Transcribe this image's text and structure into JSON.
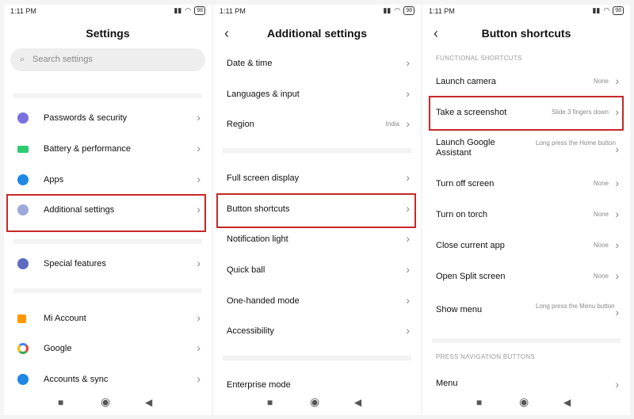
{
  "status": {
    "time": "1:11 PM",
    "battery": "98"
  },
  "screen1": {
    "title": "Settings",
    "search_placeholder": "Search settings",
    "items": [
      {
        "label": "Passwords & security",
        "icon": "fingerprint-icon",
        "color": "#7c6fe0"
      },
      {
        "label": "Battery & performance",
        "icon": "battery-icon",
        "color": "#2ecc71"
      },
      {
        "label": "Apps",
        "icon": "gear-icon",
        "color": "#1e88e5"
      },
      {
        "label": "Additional settings",
        "icon": "more-icon",
        "color": "#9fa8da"
      },
      {
        "label": "Special features",
        "icon": "special-icon",
        "color": "#5c6bc0"
      },
      {
        "label": "Mi Account",
        "icon": "mi-icon",
        "color": "#ff9800"
      },
      {
        "label": "Google",
        "icon": "google-icon",
        "color": "#4285f4"
      },
      {
        "label": "Accounts & sync",
        "icon": "person-icon",
        "color": "#1e88e5"
      }
    ]
  },
  "screen2": {
    "title": "Additional settings",
    "items": [
      {
        "label": "Date & time",
        "value": ""
      },
      {
        "label": "Languages & input",
        "value": ""
      },
      {
        "label": "Region",
        "value": "India"
      },
      {
        "label": "Full screen display",
        "value": ""
      },
      {
        "label": "Button shortcuts",
        "value": ""
      },
      {
        "label": "Notification light",
        "value": ""
      },
      {
        "label": "Quick ball",
        "value": ""
      },
      {
        "label": "One-handed mode",
        "value": ""
      },
      {
        "label": "Accessibility",
        "value": ""
      },
      {
        "label": "Enterprise mode",
        "value": ""
      }
    ]
  },
  "screen3": {
    "title": "Button shortcuts",
    "section1": "FUNCTIONAL SHORTCUTS",
    "section2": "PRESS NAVIGATION BUTTONS",
    "items": [
      {
        "label": "Launch camera",
        "value": "None"
      },
      {
        "label": "Take a screenshot",
        "value": "Slide 3 fingers down"
      },
      {
        "label": "Launch Google Assistant",
        "value": "Long press the Home button"
      },
      {
        "label": "Turn off screen",
        "value": "None"
      },
      {
        "label": "Turn on torch",
        "value": "None"
      },
      {
        "label": "Close current app",
        "value": "None"
      },
      {
        "label": "Open Split screen",
        "value": "None"
      },
      {
        "label": "Show menu",
        "value": "Long press the Menu button"
      },
      {
        "label": "Menu",
        "value": ""
      }
    ]
  },
  "highlight_color": "#c62828"
}
